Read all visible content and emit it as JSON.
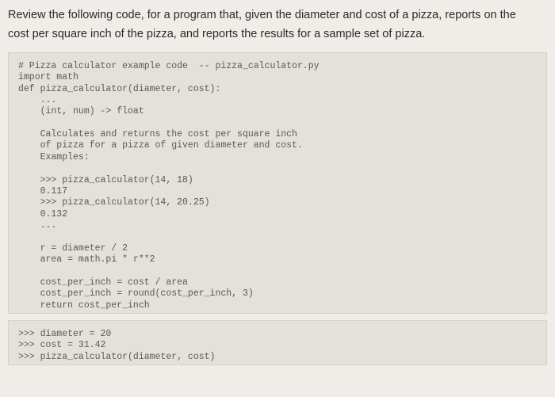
{
  "prompt": {
    "line1": "Review the following code, for a program that, given the diameter and cost of a pizza, reports on the",
    "line2": "cost per square inch of the pizza, and reports the results for a sample set of pizza."
  },
  "code_block_1": "# Pizza calculator example code  -- pizza_calculator.py\nimport math\ndef pizza_calculator(diameter, cost):\n    ...\n    (int, num) -> float\n\n    Calculates and returns the cost per square inch\n    of pizza for a pizza of given diameter and cost.\n    Examples:\n\n    >>> pizza_calculator(14, 18)\n    0.117\n    >>> pizza_calculator(14, 20.25)\n    0.132\n    ...\n\n    r = diameter / 2\n    area = math.pi * r**2\n\n    cost_per_inch = cost / area\n    cost_per_inch = round(cost_per_inch, 3)\n    return cost_per_inch\n",
  "code_block_2": ">>> diameter = 20\n>>> cost = 31.42\n>>> pizza_calculator(diameter, cost)"
}
